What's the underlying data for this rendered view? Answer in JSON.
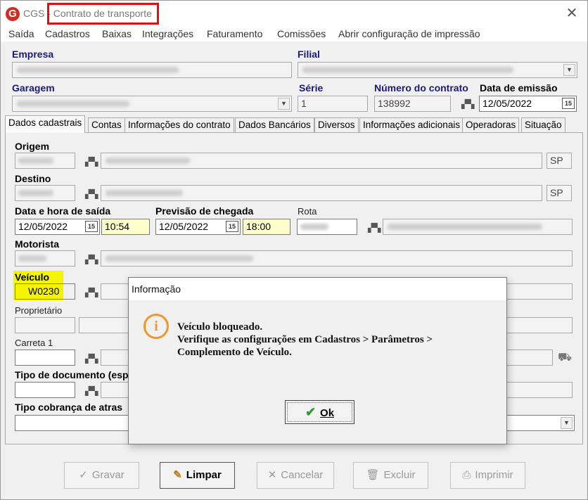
{
  "window": {
    "app_name": "CGS",
    "separator": "-",
    "title": "Contrato de transporte",
    "close_glyph": "✕",
    "logo_letter": "G"
  },
  "menu": [
    "Saída",
    "Cadastros",
    "Baixas",
    "Integrações",
    "Faturamento",
    "Comissões",
    "Abrir configuração de impressão"
  ],
  "header": {
    "empresa_label": "Empresa",
    "filial_label": "Filial",
    "garagem_label": "Garagem",
    "serie_label": "Série",
    "serie_value": "1",
    "numero_label": "Número do contrato",
    "numero_value": "138992",
    "data_emissao_label": "Data de emissão",
    "data_emissao_value": "12/05/2022"
  },
  "tabs": [
    "Dados cadastrais",
    "Contas",
    "Informações do contrato",
    "Dados Bancários",
    "Diversos",
    "Informações adicionais",
    "Operadoras",
    "Situação"
  ],
  "form": {
    "origem_label": "Origem",
    "origem_uf": "SP",
    "destino_label": "Destino",
    "destino_uf": "SP",
    "saida_label": "Data e hora de saída",
    "saida_date": "12/05/2022",
    "saida_time": "10:54",
    "chegada_label": "Previsão de chegada",
    "chegada_date": "12/05/2022",
    "chegada_time": "18:00",
    "rota_label": "Rota",
    "motorista_label": "Motorista",
    "veiculo_label": "Veículo",
    "veiculo_value": "W0230",
    "proprietario_label": "Proprietário",
    "carreta_label": "Carreta 1",
    "tipo_documento_label": "Tipo de documento (esp",
    "tipo_cobranca_label": "Tipo cobrança de atras"
  },
  "buttons": {
    "gravar": "Gravar",
    "limpar": "Limpar",
    "cancelar": "Cancelar",
    "excluir": "Excluir",
    "imprimir": "Imprimir"
  },
  "dialog": {
    "title": "Informação",
    "icon": "info-icon",
    "line1": "Veículo bloqueado.",
    "line2": "Verifique as configurações em Cadastros > Parâmetros >",
    "line3": "Complemento de Veículo.",
    "ok_label": "Ok"
  },
  "colors": {
    "title_highlight": "#e01010",
    "veiculo_highlight": "#f5f500",
    "required_field": "#ffffcc",
    "info_icon": "#f0962a",
    "label_blue": "#1a1a7a"
  }
}
